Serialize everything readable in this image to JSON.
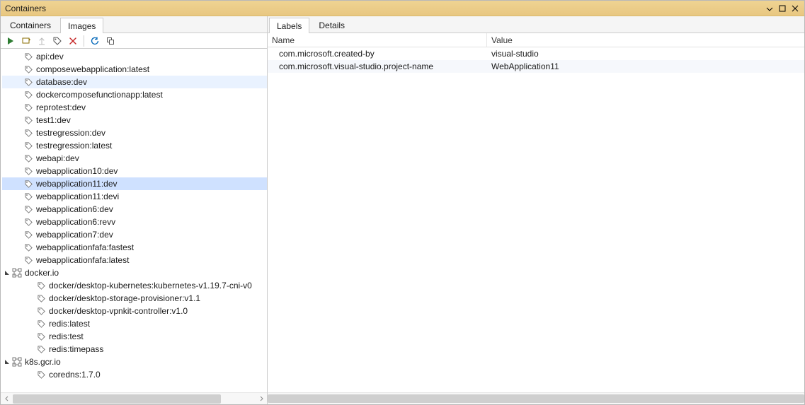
{
  "window": {
    "title": "Containers"
  },
  "left_tabs": {
    "containers": "Containers",
    "images": "Images",
    "active": "images"
  },
  "right_tabs": {
    "labels": "Labels",
    "details": "Details",
    "active": "labels"
  },
  "kv": {
    "headers": {
      "name": "Name",
      "value": "Value"
    },
    "rows": [
      {
        "name": "com.microsoft.created-by",
        "value": "visual-studio"
      },
      {
        "name": "com.microsoft.visual-studio.project-name",
        "value": "WebApplication11"
      }
    ]
  },
  "tree": {
    "local_images": [
      {
        "label": "api:dev",
        "state": ""
      },
      {
        "label": "composewebapplication:latest",
        "state": ""
      },
      {
        "label": "database:dev",
        "state": "hover"
      },
      {
        "label": "dockercomposefunctionapp:latest",
        "state": ""
      },
      {
        "label": "reprotest:dev",
        "state": ""
      },
      {
        "label": "test1:dev",
        "state": ""
      },
      {
        "label": "testregression:dev",
        "state": ""
      },
      {
        "label": "testregression:latest",
        "state": ""
      },
      {
        "label": "webapi:dev",
        "state": ""
      },
      {
        "label": "webapplication10:dev",
        "state": ""
      },
      {
        "label": "webapplication11:dev",
        "state": "sel"
      },
      {
        "label": "webapplication11:devi",
        "state": ""
      },
      {
        "label": "webapplication6:dev",
        "state": ""
      },
      {
        "label": "webapplication6:revv",
        "state": ""
      },
      {
        "label": "webapplication7:dev",
        "state": ""
      },
      {
        "label": "webapplicationfafa:fastest",
        "state": ""
      },
      {
        "label": "webapplicationfafa:latest",
        "state": ""
      }
    ],
    "docker_io": {
      "label": "docker.io",
      "children": [
        "docker/desktop-kubernetes:kubernetes-v1.19.7-cni-v0",
        "docker/desktop-storage-provisioner:v1.1",
        "docker/desktop-vpnkit-controller:v1.0",
        "redis:latest",
        "redis:test",
        "redis:timepass"
      ]
    },
    "k8s": {
      "label": "k8s.gcr.io",
      "children": [
        "coredns:1.7.0"
      ]
    }
  }
}
